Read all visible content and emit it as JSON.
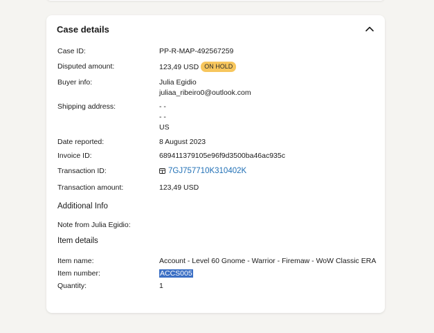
{
  "case_details": {
    "title": "Case details",
    "fields": {
      "case_id_label": "Case ID:",
      "case_id_value": "PP-R-MAP-492567259",
      "disputed_label": "Disputed amount:",
      "disputed_value": "123,49 USD",
      "disputed_status": "ON HOLD",
      "buyer_label": "Buyer info:",
      "buyer_name": "Julia Egidio",
      "buyer_email": "juliaa_ribeiro0@outlook.com",
      "shipping_label": "Shipping address:",
      "shipping_line1": "- -",
      "shipping_line2": "- -",
      "shipping_country": "US",
      "date_label": "Date reported:",
      "date_value": "8 August 2023",
      "invoice_label": "Invoice ID:",
      "invoice_value": "689411379105e96f9d3500ba46ac935c",
      "transaction_label": "Transaction ID:",
      "transaction_value": "7GJ757710K310402K",
      "amount_label": "Transaction amount:",
      "amount_value": "123,49 USD"
    }
  },
  "additional_info": {
    "title": "Additional Info",
    "note_label": "Note from Julia Egidio:",
    "note_value": ""
  },
  "item_details": {
    "title": "Item details",
    "name_label": "Item name:",
    "name_value": "Account - Level 60 Gnome - Warrior - Firemaw - WoW Classic ERA",
    "number_label": "Item number:",
    "number_value": "ACCS005",
    "quantity_label": "Quantity:",
    "quantity_value": "1"
  },
  "colors": {
    "badge": "#f7c65d",
    "link": "#1f6fb5",
    "selection": "#3b6fc4"
  },
  "icons": {
    "collapse": "chevron-up-icon",
    "transaction": "receipt-icon"
  }
}
